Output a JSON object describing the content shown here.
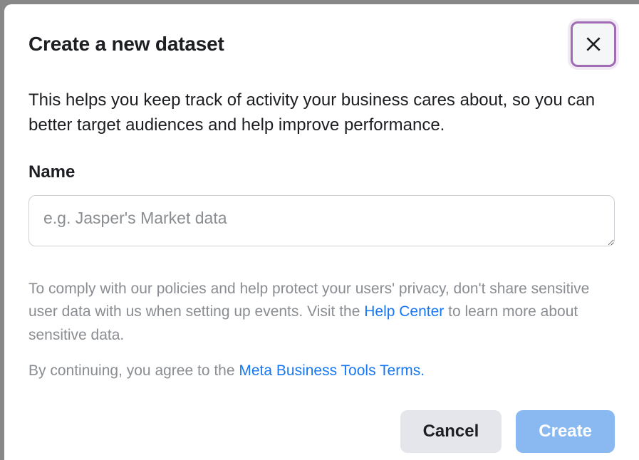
{
  "modal": {
    "title": "Create a new dataset",
    "description": "This helps you keep track of activity your business cares about, so you can better target audiences and help improve performance.",
    "name_label": "Name",
    "name_placeholder": "e.g. Jasper's Market data",
    "policy": {
      "pre": "To comply with our policies and help protect your users' privacy, don't share sensitive user data with us when setting up events. Visit the ",
      "link": "Help Center",
      "post": " to learn more about sensitive data."
    },
    "terms": {
      "pre": "By continuing, you agree to the ",
      "link": "Meta Business Tools Terms."
    },
    "buttons": {
      "cancel": "Cancel",
      "create": "Create"
    }
  }
}
